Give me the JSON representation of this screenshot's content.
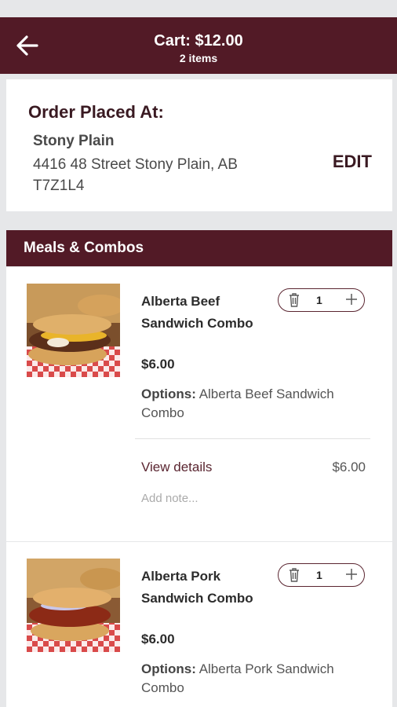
{
  "header": {
    "title": "Cart: $12.00",
    "subtitle": "2 items",
    "back_icon": "arrow-left-icon"
  },
  "order": {
    "label": "Order Placed At:",
    "store_name": "Stony Plain",
    "address": "4416 48 Street Stony Plain, AB T7Z1L4",
    "edit_label": "EDIT"
  },
  "section": {
    "title": "Meals & Combos"
  },
  "items": [
    {
      "name": "Alberta Beef Sandwich Combo",
      "quantity": "1",
      "price": "$6.00",
      "options_label": "Options:",
      "options_value": "Alberta Beef Sandwich Combo",
      "view_details": "View details",
      "line_price": "$6.00",
      "note_placeholder": "Add note..."
    },
    {
      "name": "Alberta Pork Sandwich Combo",
      "quantity": "1",
      "price": "$6.00",
      "options_label": "Options:",
      "options_value": "Alberta Pork Sandwich Combo"
    }
  ],
  "colors": {
    "brand": "#521a26",
    "background": "#e6e7e9"
  }
}
